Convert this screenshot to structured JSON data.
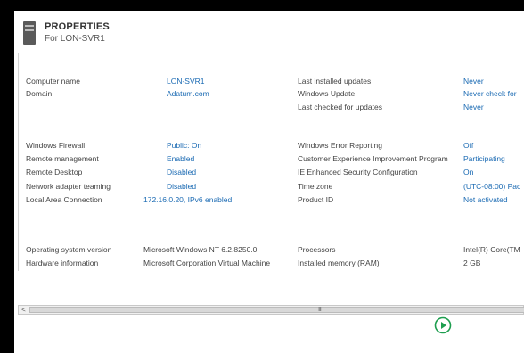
{
  "header": {
    "title": "PROPERTIES",
    "subtitle": "For LON-SVR1"
  },
  "sections": {
    "identity": {
      "left": [
        {
          "label": "Computer name",
          "value": "LON-SVR1"
        },
        {
          "label": "Domain",
          "value": "Adatum.com"
        }
      ],
      "right": [
        {
          "label": "Last installed updates",
          "value": "Never"
        },
        {
          "label": "Windows Update",
          "value": "Never check for"
        },
        {
          "label": "Last checked for updates",
          "value": "Never"
        }
      ]
    },
    "configuration": {
      "left": [
        {
          "label": "Windows Firewall",
          "value": "Public: On"
        },
        {
          "label": "Remote management",
          "value": "Enabled"
        },
        {
          "label": "Remote Desktop",
          "value": "Disabled"
        },
        {
          "label": "Network adapter teaming",
          "value": "Disabled"
        },
        {
          "label": "Local Area Connection",
          "value": "172.16.0.20, IPv6 enabled"
        }
      ],
      "right": [
        {
          "label": "Windows Error Reporting",
          "value": "Off"
        },
        {
          "label": "Customer Experience Improvement Program",
          "value": "Participating"
        },
        {
          "label": "IE Enhanced Security Configuration",
          "value": "On"
        },
        {
          "label": "Time zone",
          "value": "(UTC-08:00) Pac"
        },
        {
          "label": "Product ID",
          "value": "Not activated"
        }
      ]
    },
    "hardware": {
      "left": [
        {
          "label": "Operating system version",
          "value": "Microsoft Windows NT 6.2.8250.0"
        },
        {
          "label": "Hardware information",
          "value": "Microsoft Corporation Virtual Machine"
        }
      ],
      "right": [
        {
          "label": "Processors",
          "value": "Intel(R) Core(TM"
        },
        {
          "label": "Installed memory (RAM)",
          "value": "2 GB"
        }
      ]
    }
  },
  "scrollbar": {
    "left_arrow": "<",
    "grip": "III"
  },
  "icons": {
    "server": "server-icon",
    "play": "play-circle-icon"
  },
  "colors": {
    "link": "#1a6ab3",
    "play": "#1e9e4f"
  }
}
